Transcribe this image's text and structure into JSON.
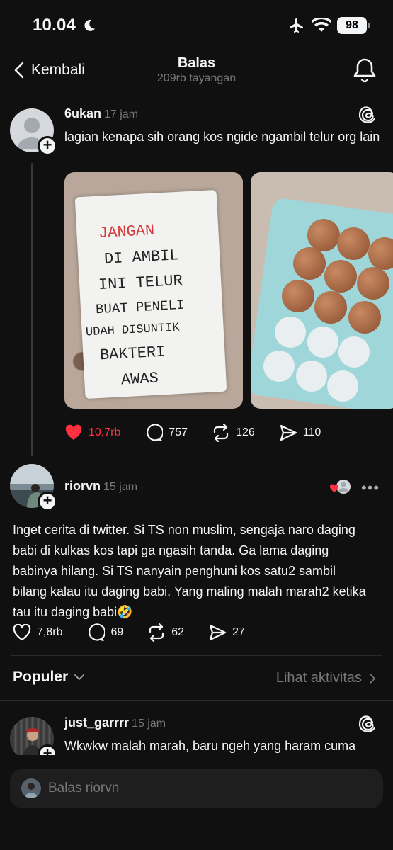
{
  "status_bar": {
    "time": "10.04",
    "battery": "98"
  },
  "header": {
    "back_label": "Kembali",
    "title": "Balas",
    "subtitle": "209rb tayangan"
  },
  "post_main": {
    "username": "6ukan",
    "time": "17 jam",
    "text": "lagian kenapa sih orang kos ngide ngambil telur org lain",
    "note_lines": [
      "JANGAN",
      "DI AMBIL",
      "INI TELUR",
      "BUAT PENELI",
      "UDAH DISUNTIK",
      "BAKTERI",
      "AWAS"
    ],
    "likes": "10,7rb",
    "comments": "757",
    "reposts": "126",
    "shares": "110"
  },
  "post_reply": {
    "username": "riorvn",
    "time": "15 jam",
    "text": "Inget cerita di twitter. Si TS non muslim, sengaja naro daging babi di kulkas kos tapi ga ngasih tanda. Ga lama daging babinya hilang. Si TS nanyain penghuni kos satu2 sambil bilang kalau itu daging babi. Yang maling malah marah2 ketika tau itu daging babi🤣",
    "likes": "7,8rb",
    "comments": "69",
    "reposts": "62",
    "shares": "27"
  },
  "sort": {
    "label": "Populer",
    "activity_link": "Lihat aktivitas"
  },
  "post_third": {
    "username": "just_garrrr",
    "time": "15 jam",
    "text": "Wkwkw malah marah, baru ngeh yang haram cuma"
  },
  "reply_bar": {
    "placeholder": "Balas riorvn"
  },
  "colors": {
    "background": "#101010",
    "like_red": "#ff3040",
    "muted": "#777777"
  }
}
